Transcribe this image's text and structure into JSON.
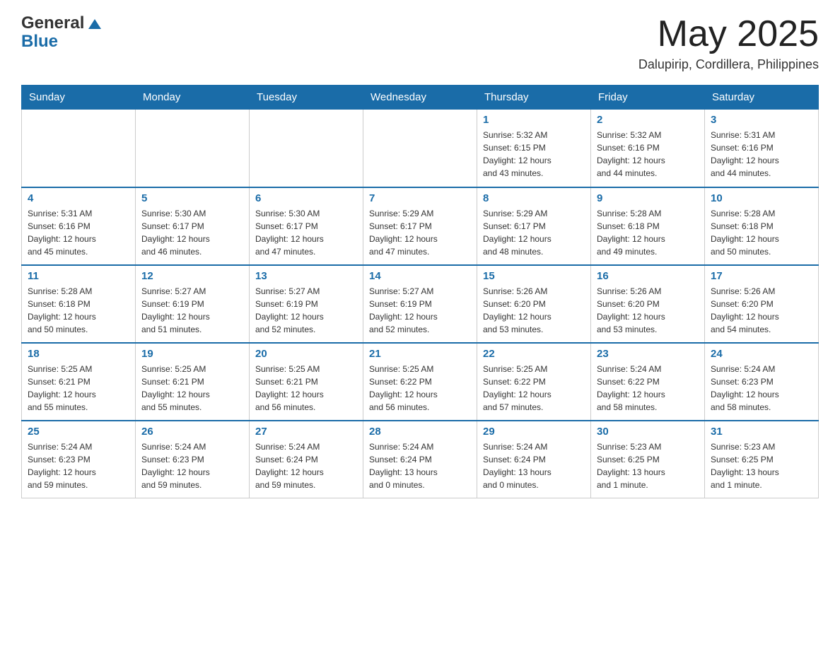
{
  "header": {
    "logo_text_black": "General",
    "logo_text_blue": "Blue",
    "month_title": "May 2025",
    "location": "Dalupirip, Cordillera, Philippines"
  },
  "weekdays": [
    "Sunday",
    "Monday",
    "Tuesday",
    "Wednesday",
    "Thursday",
    "Friday",
    "Saturday"
  ],
  "weeks": [
    [
      {
        "day": "",
        "info": ""
      },
      {
        "day": "",
        "info": ""
      },
      {
        "day": "",
        "info": ""
      },
      {
        "day": "",
        "info": ""
      },
      {
        "day": "1",
        "info": "Sunrise: 5:32 AM\nSunset: 6:15 PM\nDaylight: 12 hours\nand 43 minutes."
      },
      {
        "day": "2",
        "info": "Sunrise: 5:32 AM\nSunset: 6:16 PM\nDaylight: 12 hours\nand 44 minutes."
      },
      {
        "day": "3",
        "info": "Sunrise: 5:31 AM\nSunset: 6:16 PM\nDaylight: 12 hours\nand 44 minutes."
      }
    ],
    [
      {
        "day": "4",
        "info": "Sunrise: 5:31 AM\nSunset: 6:16 PM\nDaylight: 12 hours\nand 45 minutes."
      },
      {
        "day": "5",
        "info": "Sunrise: 5:30 AM\nSunset: 6:17 PM\nDaylight: 12 hours\nand 46 minutes."
      },
      {
        "day": "6",
        "info": "Sunrise: 5:30 AM\nSunset: 6:17 PM\nDaylight: 12 hours\nand 47 minutes."
      },
      {
        "day": "7",
        "info": "Sunrise: 5:29 AM\nSunset: 6:17 PM\nDaylight: 12 hours\nand 47 minutes."
      },
      {
        "day": "8",
        "info": "Sunrise: 5:29 AM\nSunset: 6:17 PM\nDaylight: 12 hours\nand 48 minutes."
      },
      {
        "day": "9",
        "info": "Sunrise: 5:28 AM\nSunset: 6:18 PM\nDaylight: 12 hours\nand 49 minutes."
      },
      {
        "day": "10",
        "info": "Sunrise: 5:28 AM\nSunset: 6:18 PM\nDaylight: 12 hours\nand 50 minutes."
      }
    ],
    [
      {
        "day": "11",
        "info": "Sunrise: 5:28 AM\nSunset: 6:18 PM\nDaylight: 12 hours\nand 50 minutes."
      },
      {
        "day": "12",
        "info": "Sunrise: 5:27 AM\nSunset: 6:19 PM\nDaylight: 12 hours\nand 51 minutes."
      },
      {
        "day": "13",
        "info": "Sunrise: 5:27 AM\nSunset: 6:19 PM\nDaylight: 12 hours\nand 52 minutes."
      },
      {
        "day": "14",
        "info": "Sunrise: 5:27 AM\nSunset: 6:19 PM\nDaylight: 12 hours\nand 52 minutes."
      },
      {
        "day": "15",
        "info": "Sunrise: 5:26 AM\nSunset: 6:20 PM\nDaylight: 12 hours\nand 53 minutes."
      },
      {
        "day": "16",
        "info": "Sunrise: 5:26 AM\nSunset: 6:20 PM\nDaylight: 12 hours\nand 53 minutes."
      },
      {
        "day": "17",
        "info": "Sunrise: 5:26 AM\nSunset: 6:20 PM\nDaylight: 12 hours\nand 54 minutes."
      }
    ],
    [
      {
        "day": "18",
        "info": "Sunrise: 5:25 AM\nSunset: 6:21 PM\nDaylight: 12 hours\nand 55 minutes."
      },
      {
        "day": "19",
        "info": "Sunrise: 5:25 AM\nSunset: 6:21 PM\nDaylight: 12 hours\nand 55 minutes."
      },
      {
        "day": "20",
        "info": "Sunrise: 5:25 AM\nSunset: 6:21 PM\nDaylight: 12 hours\nand 56 minutes."
      },
      {
        "day": "21",
        "info": "Sunrise: 5:25 AM\nSunset: 6:22 PM\nDaylight: 12 hours\nand 56 minutes."
      },
      {
        "day": "22",
        "info": "Sunrise: 5:25 AM\nSunset: 6:22 PM\nDaylight: 12 hours\nand 57 minutes."
      },
      {
        "day": "23",
        "info": "Sunrise: 5:24 AM\nSunset: 6:22 PM\nDaylight: 12 hours\nand 58 minutes."
      },
      {
        "day": "24",
        "info": "Sunrise: 5:24 AM\nSunset: 6:23 PM\nDaylight: 12 hours\nand 58 minutes."
      }
    ],
    [
      {
        "day": "25",
        "info": "Sunrise: 5:24 AM\nSunset: 6:23 PM\nDaylight: 12 hours\nand 59 minutes."
      },
      {
        "day": "26",
        "info": "Sunrise: 5:24 AM\nSunset: 6:23 PM\nDaylight: 12 hours\nand 59 minutes."
      },
      {
        "day": "27",
        "info": "Sunrise: 5:24 AM\nSunset: 6:24 PM\nDaylight: 12 hours\nand 59 minutes."
      },
      {
        "day": "28",
        "info": "Sunrise: 5:24 AM\nSunset: 6:24 PM\nDaylight: 13 hours\nand 0 minutes."
      },
      {
        "day": "29",
        "info": "Sunrise: 5:24 AM\nSunset: 6:24 PM\nDaylight: 13 hours\nand 0 minutes."
      },
      {
        "day": "30",
        "info": "Sunrise: 5:23 AM\nSunset: 6:25 PM\nDaylight: 13 hours\nand 1 minute."
      },
      {
        "day": "31",
        "info": "Sunrise: 5:23 AM\nSunset: 6:25 PM\nDaylight: 13 hours\nand 1 minute."
      }
    ]
  ]
}
